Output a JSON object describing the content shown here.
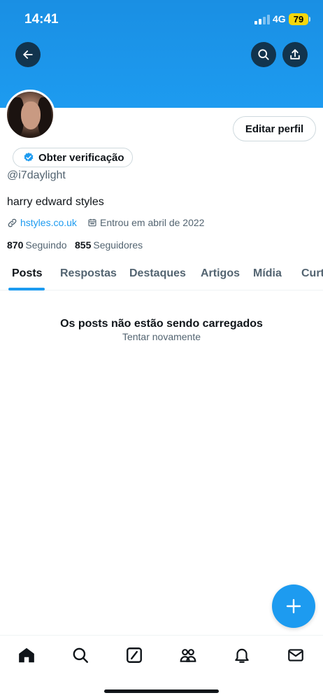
{
  "status_bar": {
    "time": "14:41",
    "network": "4G",
    "battery": "79"
  },
  "header": {
    "back_icon": "arrow-left-icon",
    "search_icon": "search-icon",
    "share_icon": "share-icon"
  },
  "profile": {
    "edit_label": "Editar perfil",
    "verify_label": "Obter verificação",
    "handle": "@i7daylight",
    "bio": "harry edward styles",
    "link": "hstyles.co.uk",
    "joined": "Entrou em abril de 2022",
    "following_count": "870",
    "following_label": "Seguindo",
    "followers_count": "855",
    "followers_label": "Seguidores"
  },
  "tabs": [
    "Posts",
    "Respostas",
    "Destaques",
    "Artigos",
    "Mídia",
    "Curt"
  ],
  "active_tab": "Posts",
  "empty_state": {
    "title": "Os posts não estão sendo carregados",
    "retry": "Tentar novamente"
  },
  "bottom_nav": [
    "home-icon",
    "search-icon",
    "grok-icon",
    "communities-icon",
    "notifications-icon",
    "messages-icon"
  ],
  "colors": {
    "accent": "#1d9bf0",
    "text": "#0f1419",
    "secondary": "#536471",
    "battery": "#f5d60b"
  }
}
